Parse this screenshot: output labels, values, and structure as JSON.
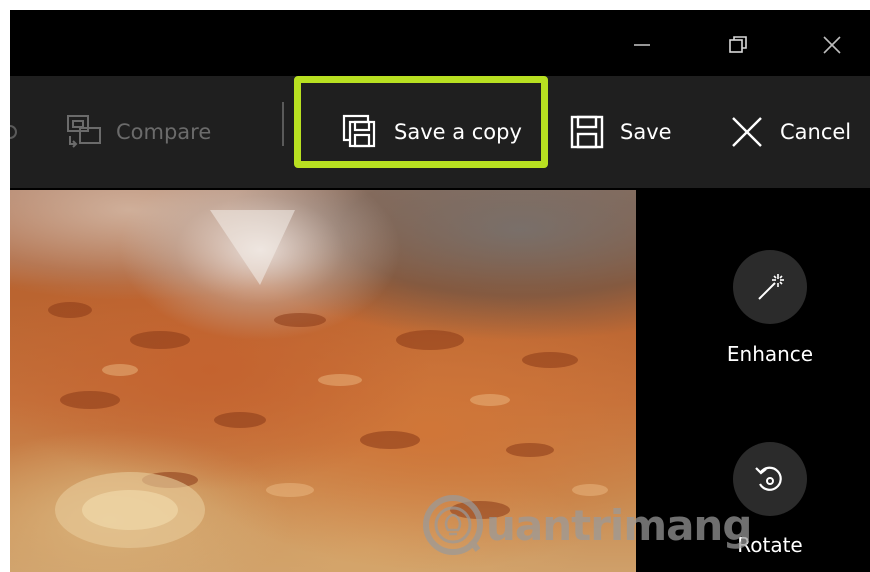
{
  "titlebar": {
    "minimize_icon": "minimize-icon",
    "maximize_icon": "restore-icon",
    "close_icon": "close-icon"
  },
  "toolbar": {
    "compare_label": "Compare",
    "save_copy_label": "Save a copy",
    "save_label": "Save",
    "cancel_label": "Cancel",
    "highlight_color": "#b8e021"
  },
  "side_panel": {
    "enhance_label": "Enhance",
    "rotate_label": "Rotate"
  },
  "watermark": {
    "text": "uantrimang"
  },
  "colors": {
    "toolbar_bg": "#1f1f1f",
    "window_bg": "#000000",
    "disabled_text": "#6b6b6b",
    "accent_highlight": "#b8e021"
  }
}
